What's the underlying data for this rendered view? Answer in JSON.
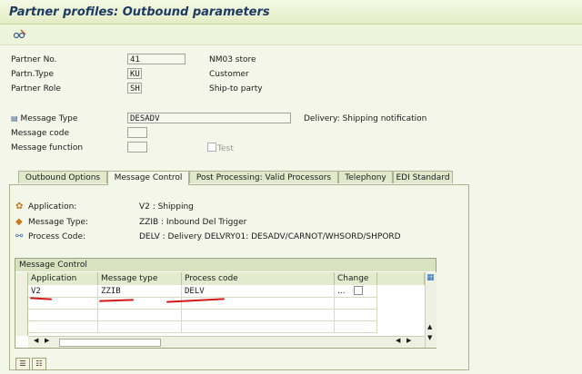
{
  "window": {
    "title": "Partner profiles: Outbound parameters"
  },
  "toolbar": {
    "display_change_icon": "glasses-pencil-icon"
  },
  "header": {
    "partner_no": {
      "label": "Partner No.",
      "value": "41",
      "description": "NM03 store"
    },
    "partner_type": {
      "label": "Partn.Type",
      "value": "KU",
      "description": "Customer"
    },
    "partner_role": {
      "label": "Partner Role",
      "value": "SH",
      "description": "Ship-to party"
    },
    "message_type": {
      "label": "Message Type",
      "value": "DESADV",
      "description": "Delivery: Shipping notification"
    },
    "message_code": {
      "label": "Message code",
      "value": ""
    },
    "message_function": {
      "label": "Message function",
      "value": ""
    },
    "test_label": "Test"
  },
  "tabs": [
    {
      "label": "Outbound Options"
    },
    {
      "label": "Message Control"
    },
    {
      "label": "Post Processing: Valid Processors"
    },
    {
      "label": "Telephony"
    },
    {
      "label": "EDI Standard"
    }
  ],
  "message_control_info": {
    "application": {
      "label": "Application:",
      "value": "V2 : Shipping"
    },
    "message_type": {
      "label": "Message Type:",
      "value": "ZZIB : Inbound Del Trigger"
    },
    "process_code": {
      "label": "Process Code:",
      "value": "DELV : Delivery DELVRY01: DESADV/CARNOT/WHSORD/SHPORD"
    }
  },
  "table": {
    "caption": "Message Control",
    "columns": [
      "Application",
      "Message type",
      "Process code",
      "Change ..."
    ],
    "rows": [
      {
        "application": "V2",
        "message_type": "ZZIB",
        "process_code": "DELV",
        "change": false
      }
    ],
    "accent_underline": "#d11a1a"
  },
  "colors": {
    "accent": "#1c3a63",
    "background": "#f3f6e8"
  }
}
